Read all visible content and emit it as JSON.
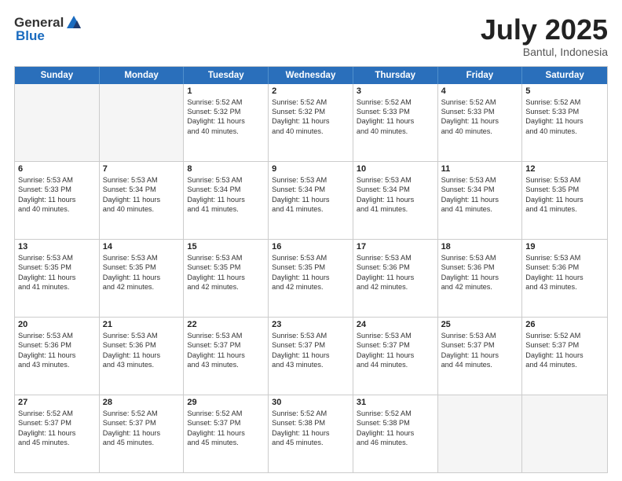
{
  "header": {
    "logo_general": "General",
    "logo_blue": "Blue",
    "month": "July 2025",
    "location": "Bantul, Indonesia"
  },
  "weekdays": [
    "Sunday",
    "Monday",
    "Tuesday",
    "Wednesday",
    "Thursday",
    "Friday",
    "Saturday"
  ],
  "weeks": [
    [
      {
        "day": "",
        "lines": []
      },
      {
        "day": "",
        "lines": []
      },
      {
        "day": "1",
        "lines": [
          "Sunrise: 5:52 AM",
          "Sunset: 5:32 PM",
          "Daylight: 11 hours",
          "and 40 minutes."
        ]
      },
      {
        "day": "2",
        "lines": [
          "Sunrise: 5:52 AM",
          "Sunset: 5:32 PM",
          "Daylight: 11 hours",
          "and 40 minutes."
        ]
      },
      {
        "day": "3",
        "lines": [
          "Sunrise: 5:52 AM",
          "Sunset: 5:33 PM",
          "Daylight: 11 hours",
          "and 40 minutes."
        ]
      },
      {
        "day": "4",
        "lines": [
          "Sunrise: 5:52 AM",
          "Sunset: 5:33 PM",
          "Daylight: 11 hours",
          "and 40 minutes."
        ]
      },
      {
        "day": "5",
        "lines": [
          "Sunrise: 5:52 AM",
          "Sunset: 5:33 PM",
          "Daylight: 11 hours",
          "and 40 minutes."
        ]
      }
    ],
    [
      {
        "day": "6",
        "lines": [
          "Sunrise: 5:53 AM",
          "Sunset: 5:33 PM",
          "Daylight: 11 hours",
          "and 40 minutes."
        ]
      },
      {
        "day": "7",
        "lines": [
          "Sunrise: 5:53 AM",
          "Sunset: 5:34 PM",
          "Daylight: 11 hours",
          "and 40 minutes."
        ]
      },
      {
        "day": "8",
        "lines": [
          "Sunrise: 5:53 AM",
          "Sunset: 5:34 PM",
          "Daylight: 11 hours",
          "and 41 minutes."
        ]
      },
      {
        "day": "9",
        "lines": [
          "Sunrise: 5:53 AM",
          "Sunset: 5:34 PM",
          "Daylight: 11 hours",
          "and 41 minutes."
        ]
      },
      {
        "day": "10",
        "lines": [
          "Sunrise: 5:53 AM",
          "Sunset: 5:34 PM",
          "Daylight: 11 hours",
          "and 41 minutes."
        ]
      },
      {
        "day": "11",
        "lines": [
          "Sunrise: 5:53 AM",
          "Sunset: 5:34 PM",
          "Daylight: 11 hours",
          "and 41 minutes."
        ]
      },
      {
        "day": "12",
        "lines": [
          "Sunrise: 5:53 AM",
          "Sunset: 5:35 PM",
          "Daylight: 11 hours",
          "and 41 minutes."
        ]
      }
    ],
    [
      {
        "day": "13",
        "lines": [
          "Sunrise: 5:53 AM",
          "Sunset: 5:35 PM",
          "Daylight: 11 hours",
          "and 41 minutes."
        ]
      },
      {
        "day": "14",
        "lines": [
          "Sunrise: 5:53 AM",
          "Sunset: 5:35 PM",
          "Daylight: 11 hours",
          "and 42 minutes."
        ]
      },
      {
        "day": "15",
        "lines": [
          "Sunrise: 5:53 AM",
          "Sunset: 5:35 PM",
          "Daylight: 11 hours",
          "and 42 minutes."
        ]
      },
      {
        "day": "16",
        "lines": [
          "Sunrise: 5:53 AM",
          "Sunset: 5:35 PM",
          "Daylight: 11 hours",
          "and 42 minutes."
        ]
      },
      {
        "day": "17",
        "lines": [
          "Sunrise: 5:53 AM",
          "Sunset: 5:36 PM",
          "Daylight: 11 hours",
          "and 42 minutes."
        ]
      },
      {
        "day": "18",
        "lines": [
          "Sunrise: 5:53 AM",
          "Sunset: 5:36 PM",
          "Daylight: 11 hours",
          "and 42 minutes."
        ]
      },
      {
        "day": "19",
        "lines": [
          "Sunrise: 5:53 AM",
          "Sunset: 5:36 PM",
          "Daylight: 11 hours",
          "and 43 minutes."
        ]
      }
    ],
    [
      {
        "day": "20",
        "lines": [
          "Sunrise: 5:53 AM",
          "Sunset: 5:36 PM",
          "Daylight: 11 hours",
          "and 43 minutes."
        ]
      },
      {
        "day": "21",
        "lines": [
          "Sunrise: 5:53 AM",
          "Sunset: 5:36 PM",
          "Daylight: 11 hours",
          "and 43 minutes."
        ]
      },
      {
        "day": "22",
        "lines": [
          "Sunrise: 5:53 AM",
          "Sunset: 5:37 PM",
          "Daylight: 11 hours",
          "and 43 minutes."
        ]
      },
      {
        "day": "23",
        "lines": [
          "Sunrise: 5:53 AM",
          "Sunset: 5:37 PM",
          "Daylight: 11 hours",
          "and 43 minutes."
        ]
      },
      {
        "day": "24",
        "lines": [
          "Sunrise: 5:53 AM",
          "Sunset: 5:37 PM",
          "Daylight: 11 hours",
          "and 44 minutes."
        ]
      },
      {
        "day": "25",
        "lines": [
          "Sunrise: 5:53 AM",
          "Sunset: 5:37 PM",
          "Daylight: 11 hours",
          "and 44 minutes."
        ]
      },
      {
        "day": "26",
        "lines": [
          "Sunrise: 5:52 AM",
          "Sunset: 5:37 PM",
          "Daylight: 11 hours",
          "and 44 minutes."
        ]
      }
    ],
    [
      {
        "day": "27",
        "lines": [
          "Sunrise: 5:52 AM",
          "Sunset: 5:37 PM",
          "Daylight: 11 hours",
          "and 45 minutes."
        ]
      },
      {
        "day": "28",
        "lines": [
          "Sunrise: 5:52 AM",
          "Sunset: 5:37 PM",
          "Daylight: 11 hours",
          "and 45 minutes."
        ]
      },
      {
        "day": "29",
        "lines": [
          "Sunrise: 5:52 AM",
          "Sunset: 5:37 PM",
          "Daylight: 11 hours",
          "and 45 minutes."
        ]
      },
      {
        "day": "30",
        "lines": [
          "Sunrise: 5:52 AM",
          "Sunset: 5:38 PM",
          "Daylight: 11 hours",
          "and 45 minutes."
        ]
      },
      {
        "day": "31",
        "lines": [
          "Sunrise: 5:52 AM",
          "Sunset: 5:38 PM",
          "Daylight: 11 hours",
          "and 46 minutes."
        ]
      },
      {
        "day": "",
        "lines": []
      },
      {
        "day": "",
        "lines": []
      }
    ]
  ]
}
